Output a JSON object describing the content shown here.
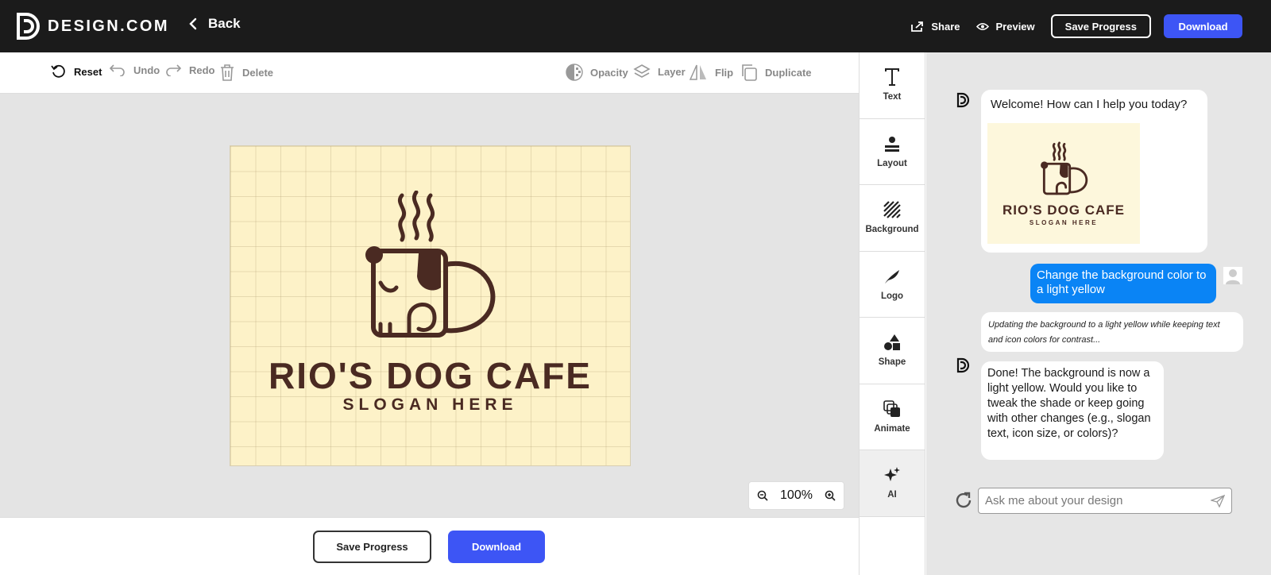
{
  "header": {
    "brand": "DESIGN.COM",
    "back_label": "Back",
    "share_label": "Share",
    "preview_label": "Preview",
    "save_label": "Save Progress",
    "download_label": "Download"
  },
  "toolbar": {
    "reset": "Reset",
    "undo": "Undo",
    "redo": "Redo",
    "delete": "Delete",
    "opacity": "Opacity",
    "layer": "Layer",
    "flip": "Flip",
    "duplicate": "Duplicate"
  },
  "canvas": {
    "title": "RIO'S DOG CAFE",
    "slogan": "SLOGAN HERE",
    "background_color": "#fdf2c8",
    "ink_color": "#4a2a22"
  },
  "zoom": {
    "value": "100%"
  },
  "bottom": {
    "save_label": "Save Progress",
    "download_label": "Download"
  },
  "side_tools": {
    "text": "Text",
    "layout": "Layout",
    "background": "Background",
    "logo": "Logo",
    "shape": "Shape",
    "animate": "Animate",
    "ai": "AI"
  },
  "chat": {
    "welcome": "Welcome! How can I help you today?",
    "thumb_title": "RIO'S DOG CAFE",
    "thumb_slogan": "SLOGAN HERE",
    "user_message": "Change the background color to a light yellow",
    "status": "Updating the background to a light yellow while keeping text and icon colors for contrast...",
    "reply": "Done! The background is now a light yellow. Would you like to tweak the shade or keep going with other changes (e.g., slogan text, icon size, or colors)?",
    "input_placeholder": "Ask me about your design"
  },
  "colors": {
    "accent": "#3d55f5",
    "user_bubble": "#0a84f5",
    "topbar": "#1b1b1b"
  }
}
